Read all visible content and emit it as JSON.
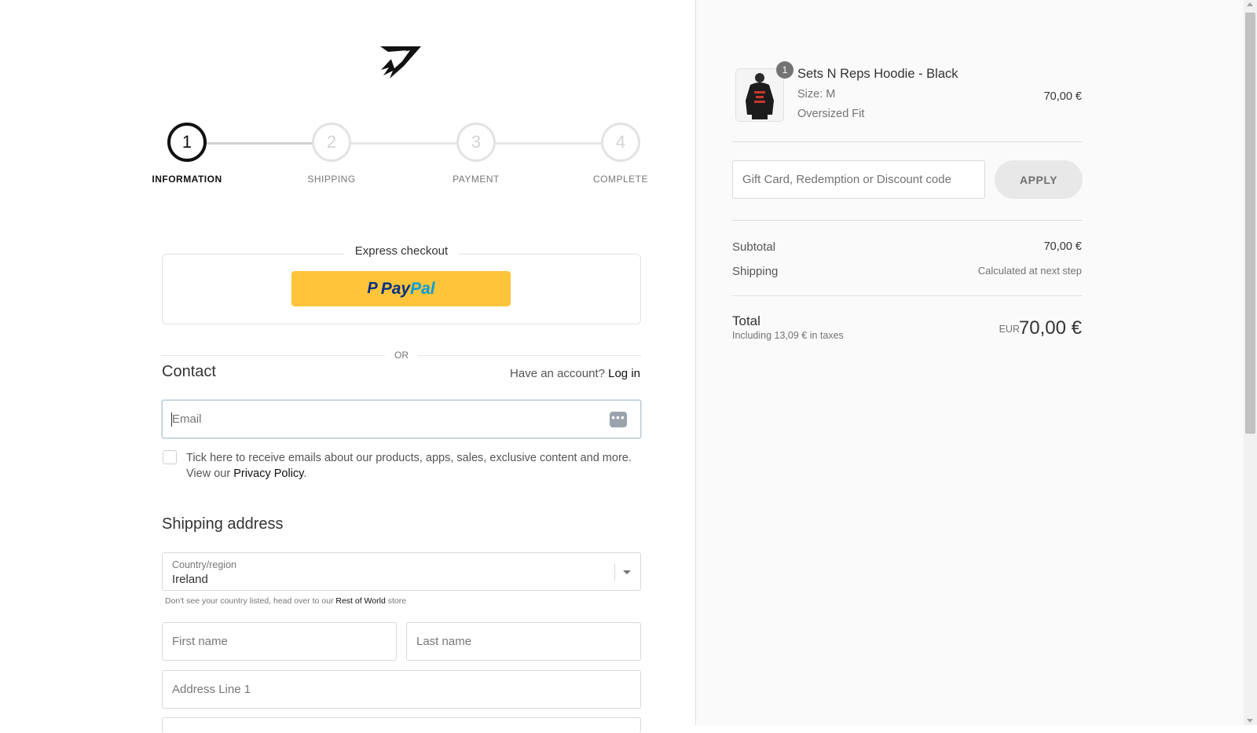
{
  "steps": [
    {
      "number": "1",
      "label": "INFORMATION"
    },
    {
      "number": "2",
      "label": "SHIPPING"
    },
    {
      "number": "3",
      "label": "PAYMENT"
    },
    {
      "number": "4",
      "label": "COMPLETE"
    }
  ],
  "express": {
    "title": "Express checkout",
    "paypal_p": "P",
    "paypal_pay": "Pay",
    "paypal_pal": "Pal"
  },
  "or_text": "OR",
  "contact": {
    "title": "Contact",
    "account_prompt": "Have an account?",
    "login_link": "Log in",
    "email_placeholder": "Email",
    "newsletter_text": "Tick here to receive emails about our products, apps, sales, exclusive content and more. View our ",
    "privacy_link": "Privacy Policy",
    "privacy_suffix": "."
  },
  "shipping_address": {
    "title": "Shipping address",
    "country_label": "Country/region",
    "country_value": "Ireland",
    "hint_prefix": "Don't see your country listed, head over to our ",
    "hint_link": "Rest of World",
    "hint_suffix": " store",
    "first_name_placeholder": "First name",
    "last_name_placeholder": "Last name",
    "address1_placeholder": "Address Line 1"
  },
  "cart": {
    "quantity": "1",
    "product_name": "Sets N Reps Hoodie - Black",
    "size": "Size: M",
    "fit": "Oversized Fit",
    "price": "70,00 €",
    "discount_placeholder": "Gift Card, Redemption or Discount code",
    "apply_label": "APPLY",
    "subtotal_label": "Subtotal",
    "subtotal_value": "70,00 €",
    "shipping_label": "Shipping",
    "shipping_value": "Calculated at next step",
    "total_label": "Total",
    "taxes_note": "Including 13,09 € in taxes",
    "currency": "EUR",
    "total_value": "70,00 €"
  },
  "colors": {
    "paypal_yellow": "#ffc439",
    "paypal_dark_blue": "#003087",
    "paypal_light_blue": "#009cde",
    "active_step": "#111111",
    "inactive_step": "#d3d3d3"
  },
  "icons": {
    "logo": "gymshark-shark-logo-icon",
    "autofill": "autofill-dots-icon",
    "dropdown": "chevron-down-icon"
  }
}
